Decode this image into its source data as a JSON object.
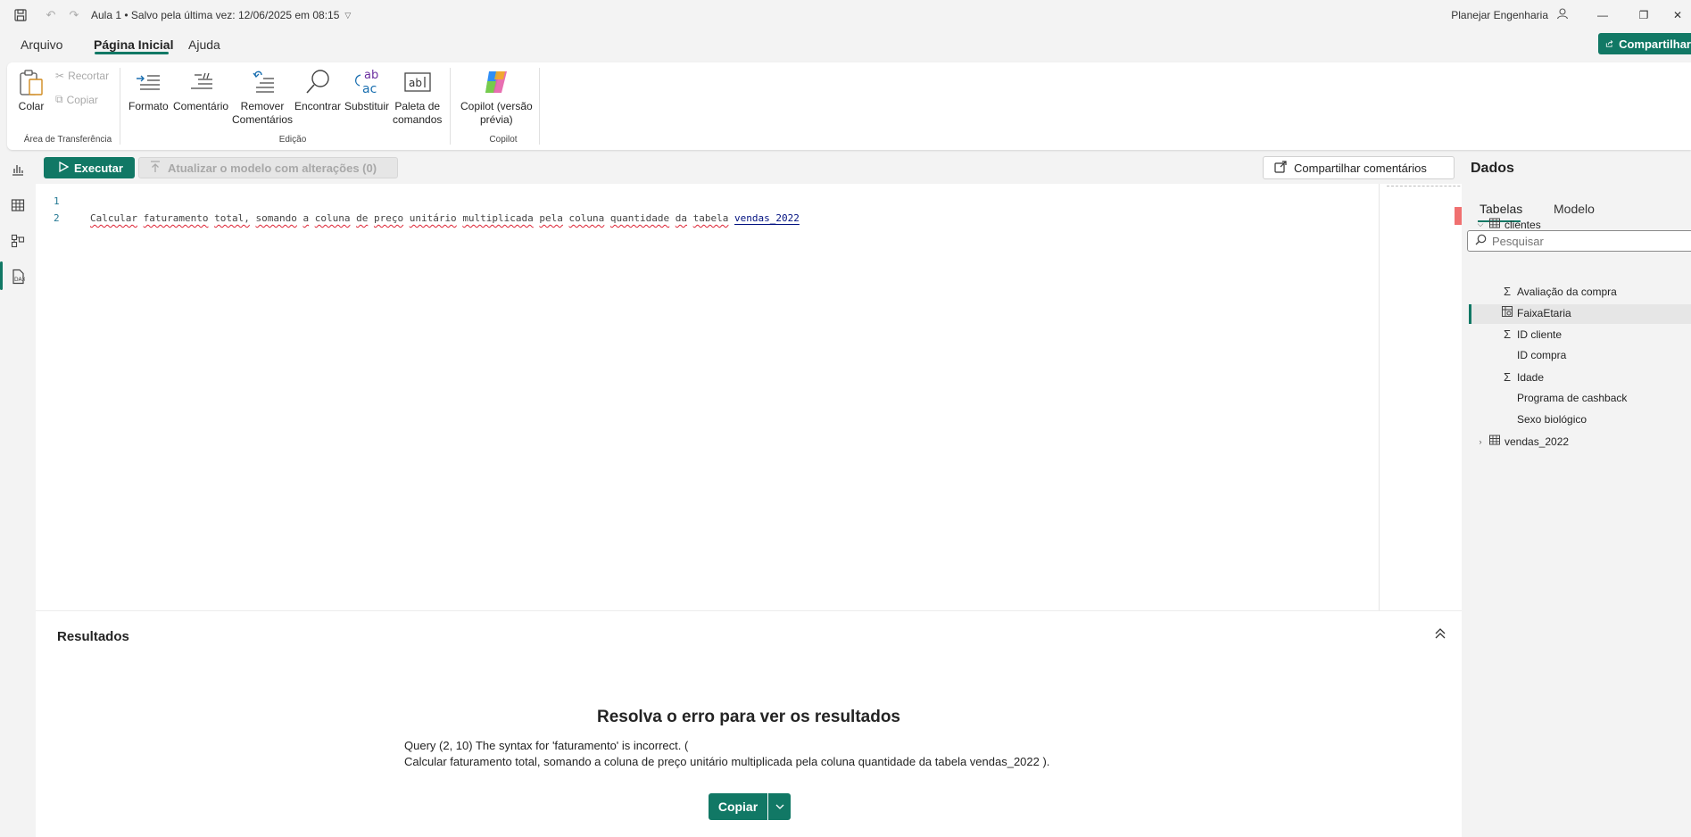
{
  "titlebar": {
    "doc_title": "Aula 1 • Salvo pela última vez: 12/06/2025 em 08:15",
    "user": "Planejar Engenharia",
    "share": "Compartilhar"
  },
  "menu": {
    "tabs": [
      "Arquivo",
      "Página Inicial",
      "Ajuda"
    ],
    "active": "Página Inicial"
  },
  "ribbon": {
    "paste": "Colar",
    "cut": "Recortar",
    "copy": "Copiar",
    "clipboard_group": "Área de Transferência",
    "format": "Formato",
    "comment": "Comentário",
    "remove_comments_1": "Remover",
    "remove_comments_2": "Comentários",
    "find": "Encontrar",
    "replace": "Substituir",
    "palette_1": "Paleta de",
    "palette_2": "comandos",
    "edit_group": "Edição",
    "copilot_1": "Copilot (versão",
    "copilot_2": "prévia)",
    "copilot_group": "Copilot"
  },
  "toolbar": {
    "run": "Executar",
    "update": "Atualizar o modelo com alterações (0)",
    "share_comments": "Compartilhar comentários"
  },
  "editor": {
    "line_numbers": [
      "1",
      "2"
    ],
    "code_words": [
      "Calcular",
      "faturamento",
      "total,",
      "somando",
      "a",
      "coluna",
      "de",
      "preço",
      "unitário",
      "multiplicada",
      "pela",
      "coluna",
      "quantidade",
      "da",
      "tabela"
    ],
    "code_ref": "vendas_2022"
  },
  "results": {
    "title": "Resultados",
    "error_title": "Resolva o erro para ver os resultados",
    "error_line1": "Query (2, 10) The syntax for 'faturamento' is incorrect. (",
    "error_line2": "Calcular faturamento total, somando a coluna de preço unitário multiplicada pela coluna quantidade da tabela vendas_2022 ).",
    "copy": "Copiar"
  },
  "data_pane": {
    "title": "Dados",
    "tabs": [
      "Tabelas",
      "Modelo"
    ],
    "search_placeholder": "Pesquisar",
    "tree": [
      {
        "label": "clientes",
        "type": "table",
        "expanded": true
      },
      {
        "label": "Avaliação da compra",
        "type": "measure"
      },
      {
        "label": "FaixaEtaria",
        "type": "calc",
        "selected": true
      },
      {
        "label": "ID cliente",
        "type": "measure"
      },
      {
        "label": "ID compra",
        "type": "field"
      },
      {
        "label": "Idade",
        "type": "measure"
      },
      {
        "label": "Programa de cashback",
        "type": "field"
      },
      {
        "label": "Sexo biológico",
        "type": "field"
      },
      {
        "label": "vendas_2022",
        "type": "table",
        "expanded": false
      }
    ]
  },
  "colors": {
    "accent": "#117865",
    "error": "#d23030"
  }
}
